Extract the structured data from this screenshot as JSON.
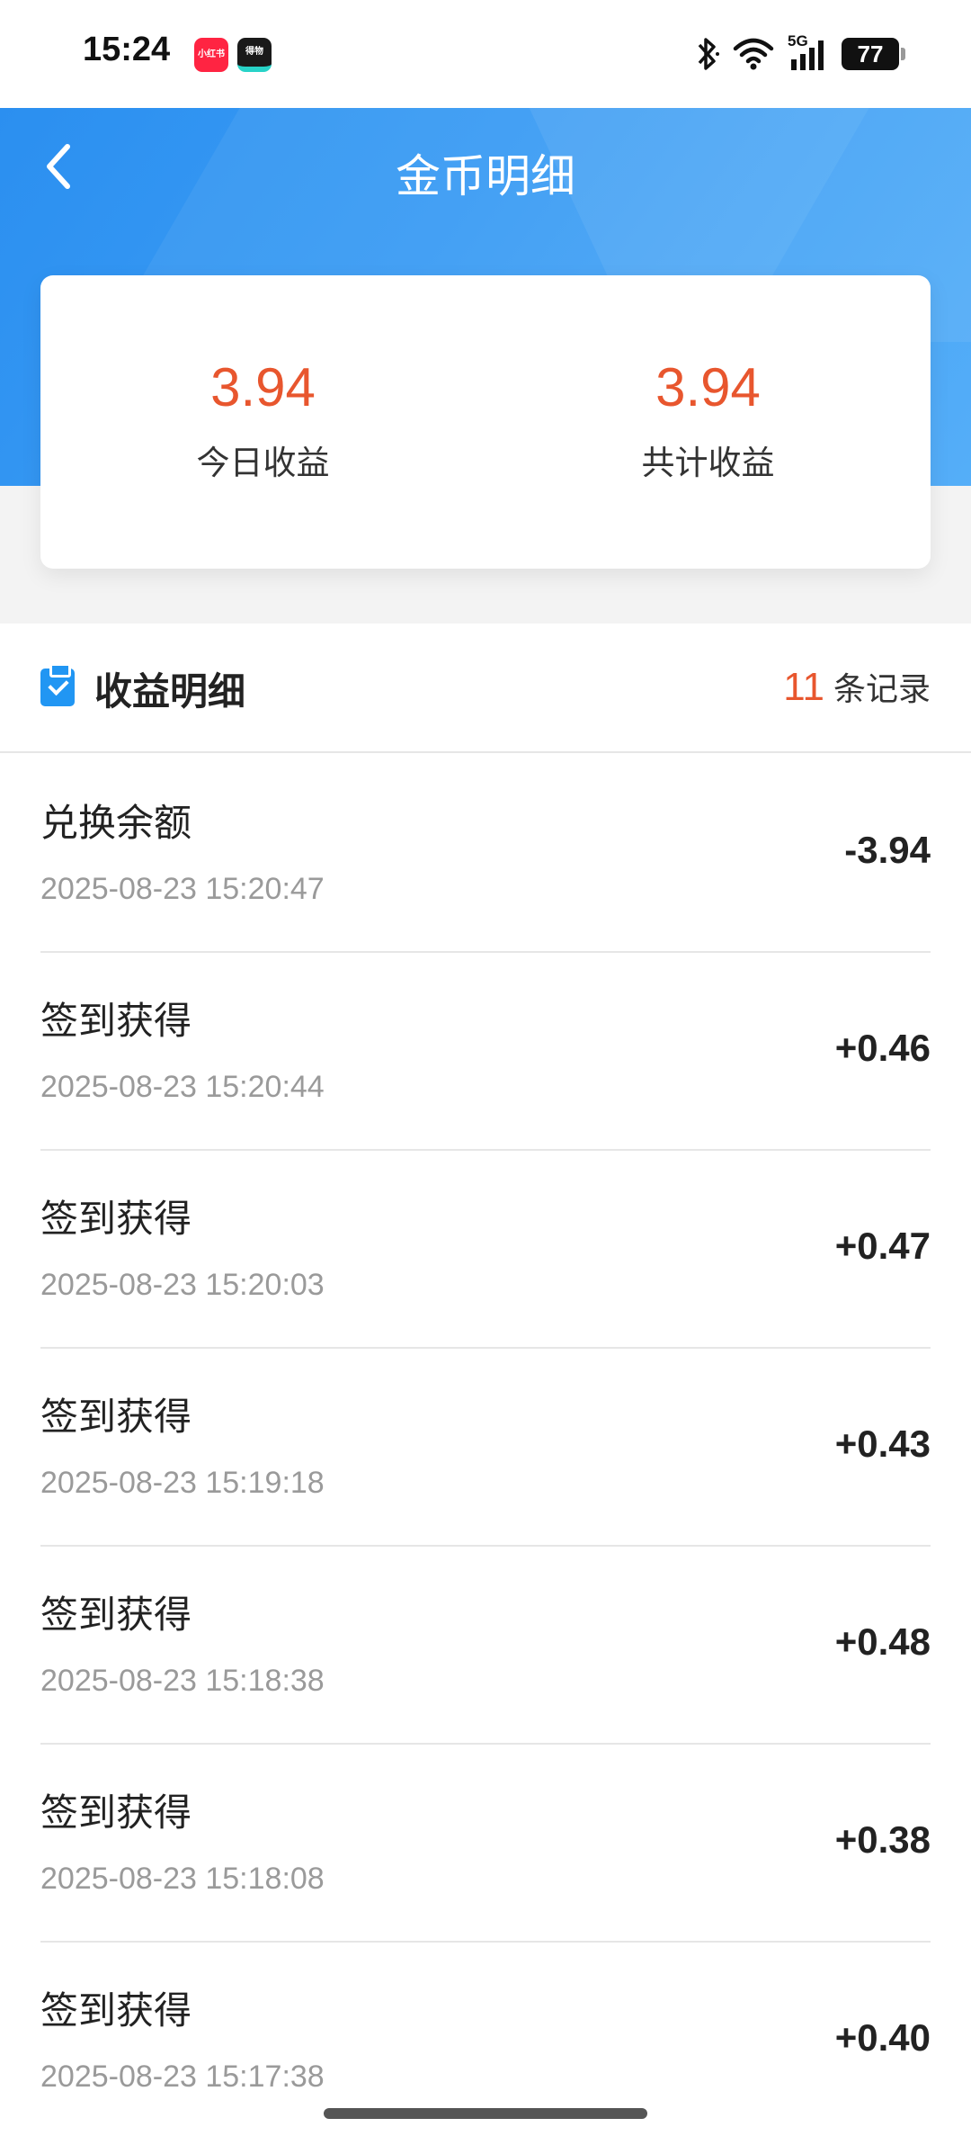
{
  "status_bar": {
    "time": "15:24",
    "app_icon_1": "小红书",
    "app_icon_2": "得物",
    "network": "5G",
    "battery": "77"
  },
  "header": {
    "title": "金币明细",
    "back_icon": "chevron-left-icon"
  },
  "summary": {
    "today_value": "3.94",
    "today_label": "今日收益",
    "total_value": "3.94",
    "total_label": "共计收益"
  },
  "details": {
    "title": "收益明细",
    "record_count": "11",
    "record_suffix": "条记录",
    "icon": "clipboard-check-icon"
  },
  "records": [
    {
      "title": "兑换余额",
      "time": "2025-08-23 15:20:47",
      "amount": "-3.94"
    },
    {
      "title": "签到获得",
      "time": "2025-08-23 15:20:44",
      "amount": "+0.46"
    },
    {
      "title": "签到获得",
      "time": "2025-08-23 15:20:03",
      "amount": "+0.47"
    },
    {
      "title": "签到获得",
      "time": "2025-08-23 15:19:18",
      "amount": "+0.43"
    },
    {
      "title": "签到获得",
      "time": "2025-08-23 15:18:38",
      "amount": "+0.48"
    },
    {
      "title": "签到获得",
      "time": "2025-08-23 15:18:08",
      "amount": "+0.38"
    },
    {
      "title": "签到获得",
      "time": "2025-08-23 15:17:38",
      "amount": "+0.40"
    }
  ],
  "colors": {
    "accent_blue": "#2b8ff0",
    "value_orange": "#e8562e"
  }
}
